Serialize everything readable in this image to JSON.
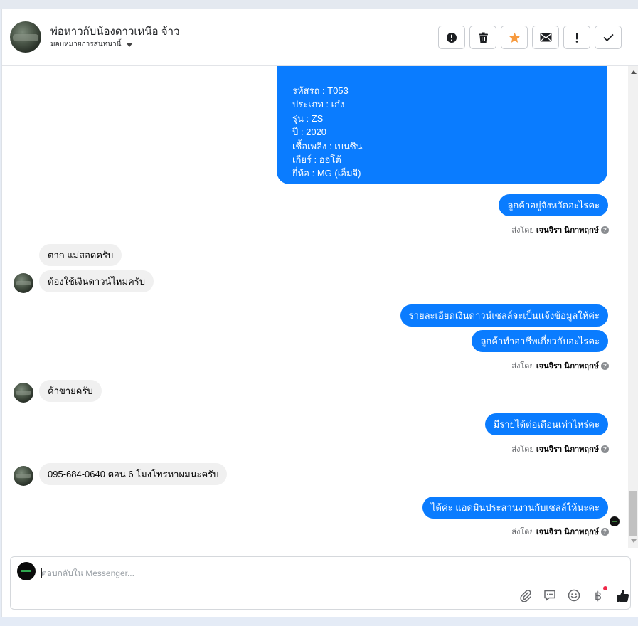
{
  "header": {
    "title": "พ่อหาวกับน้องดาวเหนือ จ้าว",
    "subtitle": "มอบหมายการสนทนานี้"
  },
  "actions": [
    {
      "icon": "alert-circle-icon",
      "name": "mark-spam-button"
    },
    {
      "icon": "trash-icon",
      "name": "delete-button"
    },
    {
      "icon": "star-icon",
      "name": "star-button",
      "color": "#f79a3e"
    },
    {
      "icon": "mail-icon",
      "name": "mark-unread-button"
    },
    {
      "icon": "exclamation-icon",
      "name": "follow-up-button"
    },
    {
      "icon": "check-icon",
      "name": "done-button"
    }
  ],
  "car_card": {
    "lines": [
      "รหัสรถ : T053",
      "ประเภท : เก๋ง",
      "รุ่น : ZS",
      "ปี : 2020",
      "เชื้อเพลิง : เบนซิน",
      "เกียร์ : ออโต้",
      "ยี่ห้อ : MG (เอ็มจี)"
    ]
  },
  "messages": {
    "m1": "ลูกค้าอยู่จังหวัดอะไรคะ",
    "m2": "ตาก แม่สอดครับ",
    "m3": "ต้องใช้เงินดาวน์ไหมครับ",
    "m4": "รายละเอียดเงินดาวน์เซลล์จะเป็นแจ้งข้อมูลให้ค่ะ",
    "m5": "ลูกค้าทำอาชีพเกี่ยวกับอะไรคะ",
    "m6": "ค้าขายครับ",
    "m7": "มีรายได้ต่อเดือนเท่าไหร่คะ",
    "m8": "095-684-0640 ตอน 6 โมงโทรหาผมนะครับ",
    "m9": "ได้ค่ะ แอดมินประสานงานกับเซลล์ให้นะคะ"
  },
  "sent_by": {
    "prefix": "ส่งโดย",
    "name": "เจนจิรา นิภาพฤกษ์"
  },
  "composer": {
    "placeholder": "ตอบกลับใน Messenger...",
    "baht_symbol": "฿"
  },
  "colors": {
    "outgoing_bubble": "#0a7cff",
    "incoming_bubble": "#f0f0f0",
    "star": "#f79a3e",
    "notification_dot": "#f02849"
  }
}
